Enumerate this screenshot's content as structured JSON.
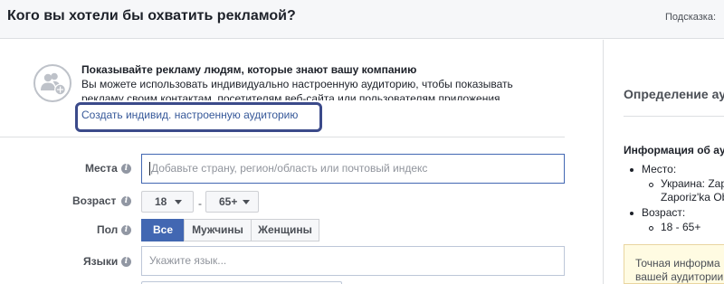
{
  "header": {
    "title": "Кого вы хотели бы охватить рекламой?",
    "hint": "Подсказка:"
  },
  "promo": {
    "icon": "add-people-icon",
    "heading": "Показывайте рекламу людям, которые знают вашу компанию",
    "text_line1": "Вы можете использовать индивидуально настроенную аудиторию, чтобы показывать",
    "text_line2": "рекламу своим контактам, посетителям веб-сайта или пользователям приложения.",
    "link": "Создать индивид. настроенную аудиторию"
  },
  "form": {
    "location": {
      "label": "Места",
      "placeholder": "Добавьте страну, регион/область или почтовый индекс"
    },
    "age": {
      "label": "Возраст",
      "min": "18",
      "max": "65+",
      "separator": "-"
    },
    "gender": {
      "label": "Пол",
      "options": [
        "Все",
        "Мужчины",
        "Женщины"
      ],
      "selected": "Все"
    },
    "languages": {
      "label": "Языки",
      "placeholder": "Укажите язык..."
    }
  },
  "right_panel": {
    "title": "Определение ау",
    "info_heading": "Информация об ау",
    "location_label": "Место:",
    "location_value_line1": "Украина: Zap",
    "location_value_line2": "Zaporiz'ka Ob",
    "age_label": "Возраст:",
    "age_value": "18 - 65+",
    "warning_line1": "Точная информа",
    "warning_line2": "вашей аудитории"
  },
  "colors": {
    "link": "#365899",
    "accent": "#4267b2",
    "highlight_border": "#3b4a8a",
    "warning_bg": "#fffbe2"
  }
}
